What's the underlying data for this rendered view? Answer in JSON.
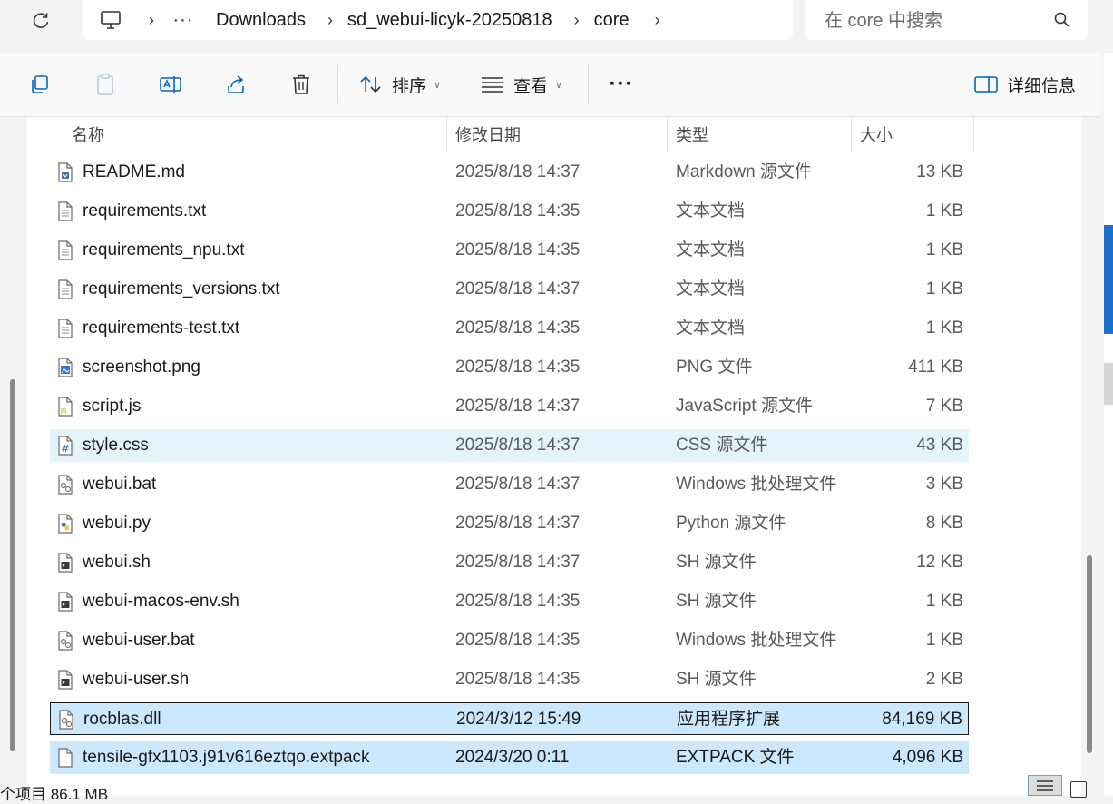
{
  "address_bar": {
    "segments": [
      "Downloads",
      "sd_webui-licyk-20250818",
      "core"
    ],
    "overflow_label": "···"
  },
  "search": {
    "placeholder": "在 core 中搜索"
  },
  "toolbar": {
    "sort_label": "排序",
    "view_label": "查看",
    "more_label": "···",
    "details_label": "详细信息"
  },
  "columns": {
    "name": "名称",
    "date": "修改日期",
    "type": "类型",
    "size": "大小"
  },
  "files": [
    {
      "name": "README.md",
      "date": "2025/8/18 14:37",
      "type": "Markdown 源文件",
      "size": "13 KB",
      "icon": "markdown-file-icon",
      "state": ""
    },
    {
      "name": "requirements.txt",
      "date": "2025/8/18 14:35",
      "type": "文本文档",
      "size": "1 KB",
      "icon": "text-file-icon",
      "state": ""
    },
    {
      "name": "requirements_npu.txt",
      "date": "2025/8/18 14:35",
      "type": "文本文档",
      "size": "1 KB",
      "icon": "text-file-icon",
      "state": ""
    },
    {
      "name": "requirements_versions.txt",
      "date": "2025/8/18 14:37",
      "type": "文本文档",
      "size": "1 KB",
      "icon": "text-file-icon",
      "state": ""
    },
    {
      "name": "requirements-test.txt",
      "date": "2025/8/18 14:35",
      "type": "文本文档",
      "size": "1 KB",
      "icon": "text-file-icon",
      "state": ""
    },
    {
      "name": "screenshot.png",
      "date": "2025/8/18 14:35",
      "type": "PNG 文件",
      "size": "411 KB",
      "icon": "image-file-icon",
      "state": ""
    },
    {
      "name": "script.js",
      "date": "2025/8/18 14:37",
      "type": "JavaScript 源文件",
      "size": "7 KB",
      "icon": "js-file-icon",
      "state": ""
    },
    {
      "name": "style.css",
      "date": "2025/8/18 14:37",
      "type": "CSS 源文件",
      "size": "43 KB",
      "icon": "css-file-icon",
      "state": "hover"
    },
    {
      "name": "webui.bat",
      "date": "2025/8/18 14:37",
      "type": "Windows 批处理文件",
      "size": "3 KB",
      "icon": "batch-file-icon",
      "state": ""
    },
    {
      "name": "webui.py",
      "date": "2025/8/18 14:37",
      "type": "Python 源文件",
      "size": "8 KB",
      "icon": "python-file-icon",
      "state": ""
    },
    {
      "name": "webui.sh",
      "date": "2025/8/18 14:37",
      "type": "SH 源文件",
      "size": "12 KB",
      "icon": "shell-file-icon",
      "state": ""
    },
    {
      "name": "webui-macos-env.sh",
      "date": "2025/8/18 14:35",
      "type": "SH 源文件",
      "size": "1 KB",
      "icon": "shell-file-icon",
      "state": ""
    },
    {
      "name": "webui-user.bat",
      "date": "2025/8/18 14:35",
      "type": "Windows 批处理文件",
      "size": "1 KB",
      "icon": "batch-file-icon",
      "state": ""
    },
    {
      "name": "webui-user.sh",
      "date": "2025/8/18 14:35",
      "type": "SH 源文件",
      "size": "2 KB",
      "icon": "shell-file-icon",
      "state": ""
    },
    {
      "name": "rocblas.dll",
      "date": "2024/3/12 15:49",
      "type": "应用程序扩展",
      "size": "84,169 KB",
      "icon": "dll-file-icon",
      "state": "focused"
    },
    {
      "name": "tensile-gfx1103.j91v616eztqo.extpack",
      "date": "2024/3/20 0:11",
      "type": "EXTPACK 文件",
      "size": "4,096 KB",
      "icon": "generic-file-icon",
      "state": "selected"
    }
  ],
  "status": {
    "text": "个项目  86.1 MB"
  },
  "colors": {
    "selection": "#cce8ff",
    "hover": "#e5f3fb",
    "accent": "#0067c0"
  }
}
